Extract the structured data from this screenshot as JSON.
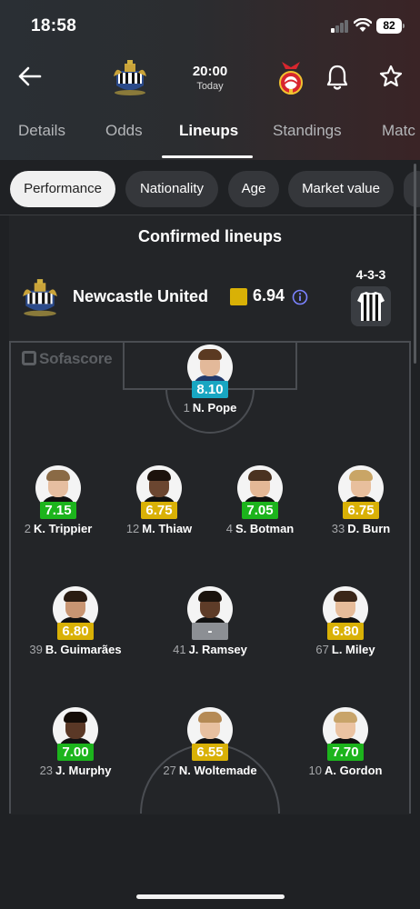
{
  "status_bar": {
    "time": "18:58",
    "battery": "82"
  },
  "header": {
    "match_time": "20:00",
    "match_day": "Today"
  },
  "tabs": [
    {
      "label": "Details",
      "active": false
    },
    {
      "label": "Odds",
      "active": false
    },
    {
      "label": "Lineups",
      "active": true
    },
    {
      "label": "Standings",
      "active": false
    },
    {
      "label": "Matc",
      "active": false
    }
  ],
  "chips": [
    {
      "label": "Performance",
      "active": true
    },
    {
      "label": "Nationality",
      "active": false
    },
    {
      "label": "Age",
      "active": false
    },
    {
      "label": "Market value",
      "active": false
    }
  ],
  "lineup": {
    "title": "Confirmed lineups",
    "team_name": "Newcastle United",
    "team_rating": "6.94",
    "formation": "4-3-3",
    "watermark": "Sofascore"
  },
  "colors": {
    "rating_green": "#1cb41c",
    "rating_yellow": "#d9b106",
    "rating_teal": "#18a6c2",
    "rating_grey": "#8c8f94"
  },
  "players": [
    {
      "number": "1",
      "name": "N. Pope",
      "rating": "8.10",
      "rating_color": "teal"
    },
    {
      "number": "2",
      "name": "K. Trippier",
      "rating": "7.15",
      "rating_color": "green"
    },
    {
      "number": "12",
      "name": "M. Thiaw",
      "rating": "6.75",
      "rating_color": "yellow"
    },
    {
      "number": "4",
      "name": "S. Botman",
      "rating": "7.05",
      "rating_color": "green"
    },
    {
      "number": "33",
      "name": "D. Burn",
      "rating": "6.75",
      "rating_color": "yellow"
    },
    {
      "number": "39",
      "name": "B. Guimarães",
      "rating": "6.80",
      "rating_color": "yellow"
    },
    {
      "number": "41",
      "name": "J. Ramsey",
      "rating": "-",
      "rating_color": "grey"
    },
    {
      "number": "67",
      "name": "L. Miley",
      "rating": "6.80",
      "rating_color": "yellow"
    },
    {
      "number": "23",
      "name": "J. Murphy",
      "rating": "7.00",
      "rating_color": "green"
    },
    {
      "number": "27",
      "name": "N. Woltemade",
      "rating": "6.55",
      "rating_color": "yellow"
    },
    {
      "number": "10",
      "name": "A. Gordon",
      "rating": "7.70",
      "rating_color": "green"
    }
  ]
}
